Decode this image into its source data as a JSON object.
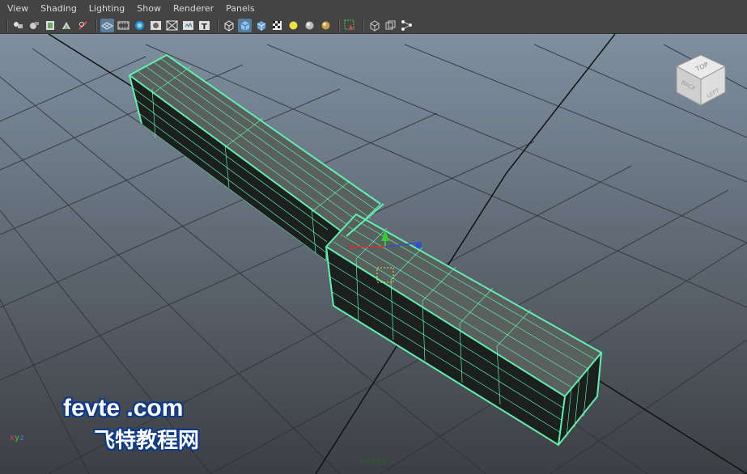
{
  "menu": {
    "items": [
      "View",
      "Shading",
      "Lighting",
      "Show",
      "Renderer",
      "Panels"
    ]
  },
  "toolbar": {
    "groups": [
      [
        "camera-attributes-icon",
        "bookmark-icon",
        "image-plane-icon",
        "2d-pan-zoom-icon",
        "grease-pencil-icon"
      ],
      [
        "grid-icon",
        "film-gate-icon",
        "resolution-gate-icon",
        "gate-mask-icon",
        "field-chart-icon",
        "safe-action-icon",
        "safe-title-icon"
      ],
      [
        "wireframe-icon",
        "smooth-shade-icon",
        "default-material-icon",
        "textured-icon",
        "use-all-lights-icon",
        "shadows-icon",
        "ambient-occlusion-icon"
      ],
      [
        "isolate-select-icon"
      ],
      [
        "xray-icon",
        "xray-joints-icon",
        "xray-components-icon"
      ]
    ],
    "active": [
      "smooth-shade-icon",
      "grid-icon"
    ]
  },
  "viewport": {
    "camera_name": "persp",
    "axis": {
      "x": "x",
      "y": "y",
      "z": "z"
    },
    "viewcube": {
      "top": "TOP",
      "back": "BACK",
      "left": "LEFT"
    },
    "wire_color": "#5ff0b0",
    "face_color": "#1e2420"
  },
  "watermark": {
    "line1": "fevte .com",
    "line2": "飞特教程网"
  }
}
